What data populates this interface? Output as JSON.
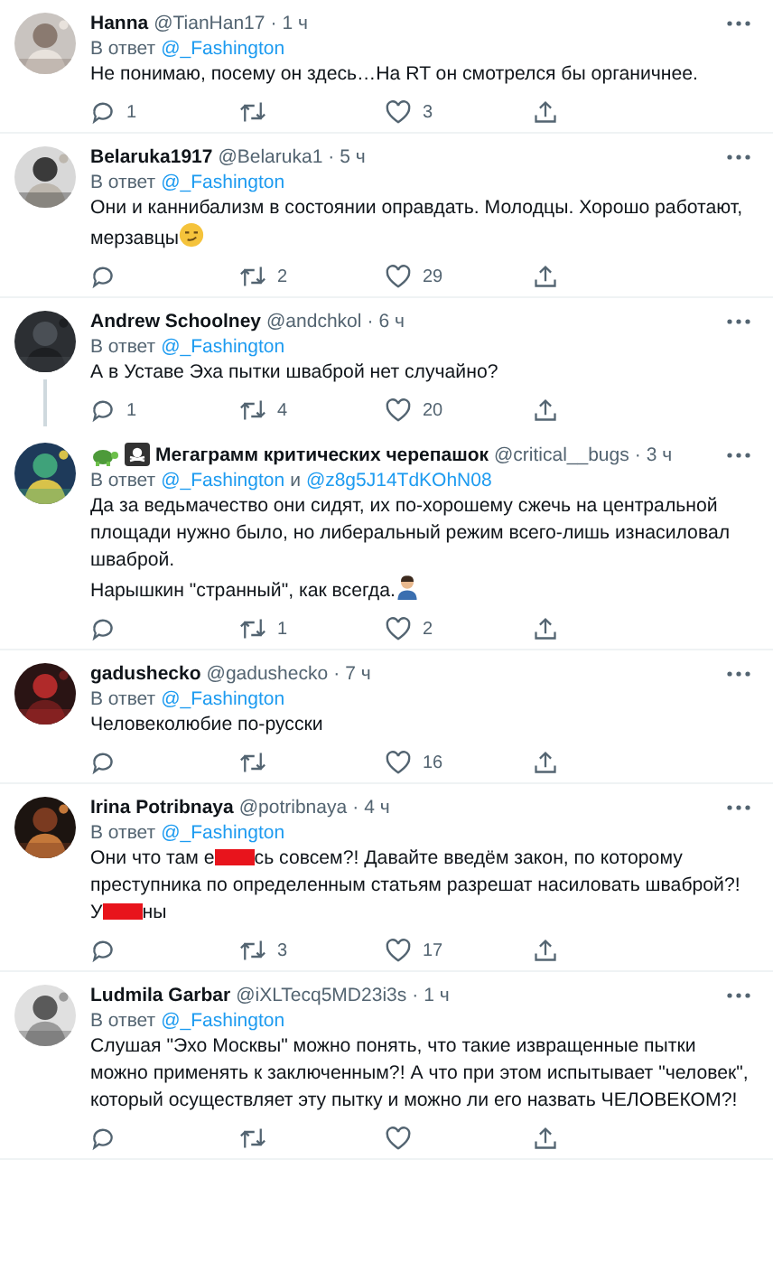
{
  "tweets": [
    {
      "name": "Hanna",
      "handle": "@TianHan17",
      "dot": "·",
      "time": "1 ч",
      "avatar": {
        "kind": "picture"
      },
      "reply_to": [
        {
          "kind": "label",
          "text": "В ответ"
        },
        {
          "kind": "mention",
          "text": "@_Fashington"
        }
      ],
      "body": [
        {
          "kind": "text",
          "text": "Не понимаю, посему он здесь…На RT он смотрелся бы органичнее."
        }
      ],
      "counts": {
        "reply": "1",
        "like": "3"
      },
      "thread_below": false
    },
    {
      "name": "Belaruka1917",
      "handle": "@Belaruka1",
      "dot": "·",
      "time": "5 ч",
      "avatar": {
        "kind": "picture"
      },
      "reply_to": [
        {
          "kind": "label",
          "text": "В ответ"
        },
        {
          "kind": "mention",
          "text": "@_Fashington"
        }
      ],
      "body": [
        {
          "kind": "text",
          "text": "Они и каннибализм в состоянии оправдать. Молодцы. Хорошо работают, мерзавцы"
        },
        {
          "kind": "smirk-emoji"
        }
      ],
      "counts": {
        "retweet": "2",
        "like": "29"
      },
      "thread_below": false
    },
    {
      "name": "Andrew Schoolney",
      "handle": "@andchkol",
      "dot": "·",
      "time": "6 ч",
      "avatar": {
        "kind": "picture"
      },
      "reply_to": [
        {
          "kind": "label",
          "text": "В ответ"
        },
        {
          "kind": "mention",
          "text": "@_Fashington"
        }
      ],
      "body": [
        {
          "kind": "text",
          "text": "А в Уставе Эха пытки шваброй нет случайно?"
        }
      ],
      "counts": {
        "reply": "1",
        "retweet": "4",
        "like": "20"
      },
      "thread_below": true
    },
    {
      "name_badges": [
        {
          "kind": "turtle"
        },
        {
          "kind": "pirate-flag"
        }
      ],
      "name": "Мегаграмм критических черепашок",
      "handle": "@critical__bugs",
      "dot": "·",
      "time": "3 ч",
      "avatar": {
        "kind": "picture"
      },
      "reply_to": [
        {
          "kind": "label",
          "text": "В ответ"
        },
        {
          "kind": "mention",
          "text": "@_Fashington"
        },
        {
          "kind": "label",
          "text": "и"
        },
        {
          "kind": "mention",
          "text": "@z8g5J14TdKOhN08"
        }
      ],
      "body": [
        {
          "kind": "text",
          "text": "Да за ведьмачество они сидят, их по-хорошему сжечь на центральной площади нужно было, но либеральный режим всего-лишь изнасиловал шваброй.\nНарышкин \"странный\", как всегда."
        },
        {
          "kind": "facepalm-emoji"
        }
      ],
      "counts": {
        "retweet": "1",
        "like": "2"
      },
      "thread_below": false
    },
    {
      "name": "gadushecko",
      "handle": "@gadushecko",
      "dot": "·",
      "time": "7 ч",
      "avatar": {
        "kind": "picture"
      },
      "reply_to": [
        {
          "kind": "label",
          "text": "В ответ"
        },
        {
          "kind": "mention",
          "text": "@_Fashington"
        }
      ],
      "body": [
        {
          "kind": "text",
          "text": "Человеколюбие по-русски"
        }
      ],
      "counts": {
        "like": "16"
      },
      "thread_below": false
    },
    {
      "name": "Irina Potribnaya",
      "handle": "@potribnaya",
      "dot": "·",
      "time": "4 ч",
      "avatar": {
        "kind": "picture"
      },
      "reply_to": [
        {
          "kind": "label",
          "text": "В ответ"
        },
        {
          "kind": "mention",
          "text": "@_Fashington"
        }
      ],
      "body": [
        {
          "kind": "text",
          "text": "Они что там е"
        },
        {
          "kind": "redaction"
        },
        {
          "kind": "text",
          "text": "сь совсем?! Давайте введём закон, по которому преступника по определенным статьям разрешат насиловать шваброй?!\nУ"
        },
        {
          "kind": "redaction"
        },
        {
          "kind": "text",
          "text": "ны"
        }
      ],
      "counts": {
        "retweet": "3",
        "like": "17"
      },
      "thread_below": false
    },
    {
      "name": "Ludmila Garbar",
      "handle": "@iXLTecq5MD23i3s",
      "dot": "·",
      "time": "1 ч",
      "avatar": {
        "kind": "picture"
      },
      "reply_to": [
        {
          "kind": "label",
          "text": "В ответ"
        },
        {
          "kind": "mention",
          "text": "@_Fashington"
        }
      ],
      "body": [
        {
          "kind": "text",
          "text": "Слушая \"Эхо Москвы\" можно понять, что такие извращенные пытки можно применять к заключенным?! А что при этом испытывает \"человек\", который осуществляет эту пытку и можно ли его назвать ЧЕЛОВЕКОМ?!"
        }
      ],
      "thread_below": false
    }
  ]
}
